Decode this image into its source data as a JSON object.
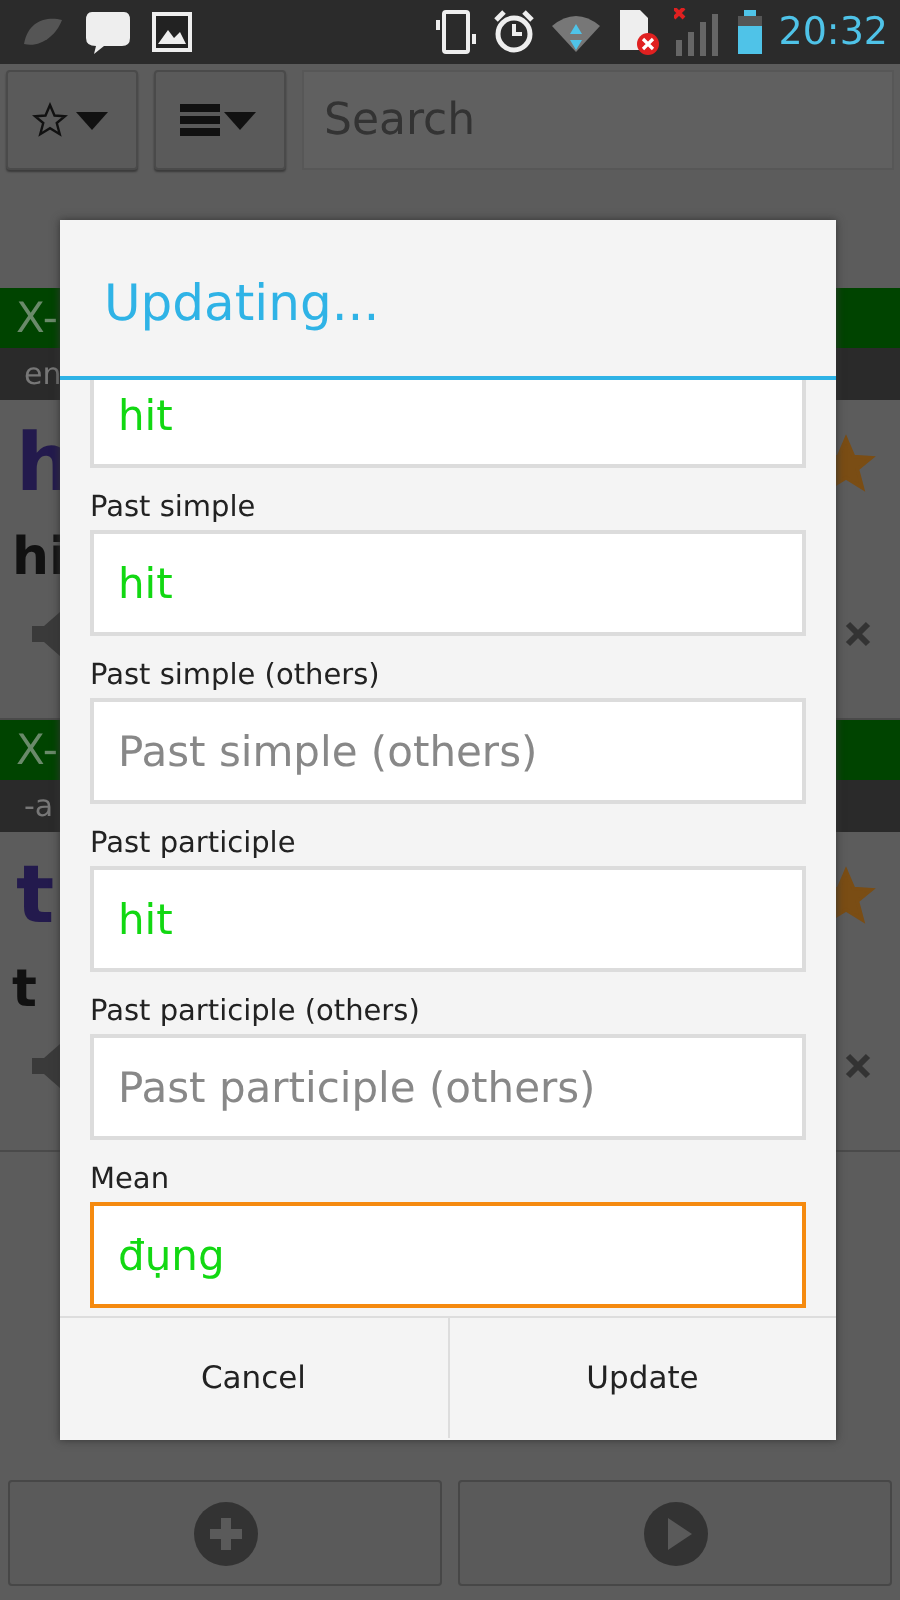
{
  "status_bar": {
    "time": "20:32"
  },
  "toolbar": {
    "search": {
      "placeholder": "Search"
    }
  },
  "list": [
    {
      "tag": "X-",
      "subtitle": "en",
      "word": "h",
      "meaning": "hi",
      "starred": true
    },
    {
      "tag": "X-",
      "subtitle": "-a",
      "word": "t",
      "meaning": "t",
      "starred": true
    }
  ],
  "dialog": {
    "title": "Updating...",
    "fields": [
      {
        "value": "hit",
        "focused": false
      },
      {
        "label": "Past simple",
        "value": "hit",
        "focused": false
      },
      {
        "label": "Past simple (others)",
        "placeholder": "Past simple (others)",
        "focused": false
      },
      {
        "label": "Past participle",
        "value": "hit",
        "focused": false
      },
      {
        "label": "Past participle (others)",
        "placeholder": "Past participle (others)",
        "focused": false
      },
      {
        "label": "Mean",
        "value": "đụng",
        "focused": true
      }
    ],
    "buttons": [
      "Cancel",
      "Update"
    ]
  }
}
